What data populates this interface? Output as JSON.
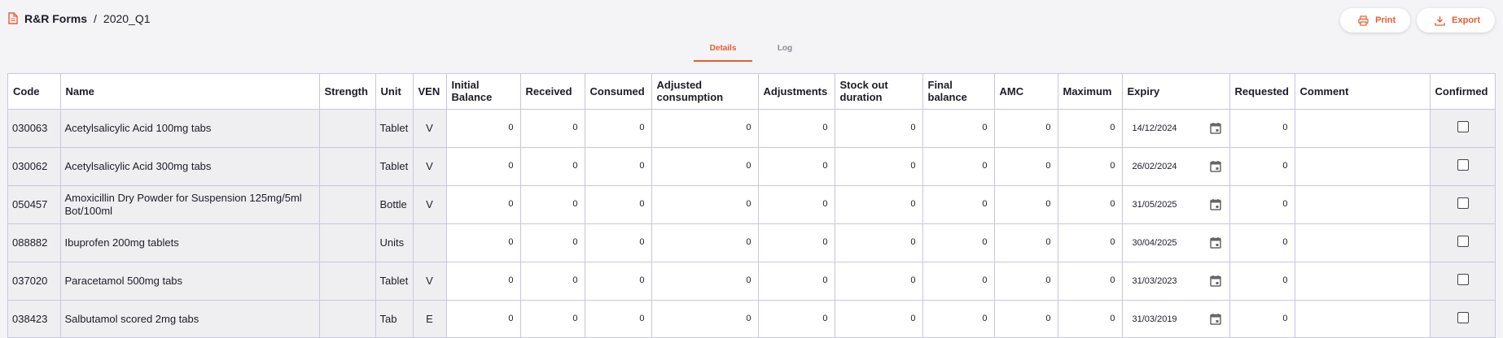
{
  "breadcrumb": {
    "root": "R&R Forms",
    "separator": "/",
    "current": "2020_Q1"
  },
  "toolbar": {
    "print_label": "Print",
    "export_label": "Export"
  },
  "tabs": [
    {
      "label": "Details"
    },
    {
      "label": "Log"
    }
  ],
  "colors": {
    "accent": "#e95c30",
    "border": "#c7c7e0",
    "readonly_cell": "#efeff1"
  },
  "icons": {
    "form": "document-icon",
    "print": "printer-icon",
    "export": "download-icon",
    "expiry": "calendar-icon"
  },
  "table": {
    "columns": [
      {
        "label": "Code"
      },
      {
        "label": "Name"
      },
      {
        "label": "Strength"
      },
      {
        "label": "Unit"
      },
      {
        "label": "VEN"
      },
      {
        "label": "Initial Balance"
      },
      {
        "label": "Received"
      },
      {
        "label": "Consumed"
      },
      {
        "label": "Adjusted consumption"
      },
      {
        "label": "Adjustments"
      },
      {
        "label": "Stock out duration"
      },
      {
        "label": "Final balance"
      },
      {
        "label": "AMC"
      },
      {
        "label": "Maximum"
      },
      {
        "label": "Expiry"
      },
      {
        "label": "Requested"
      },
      {
        "label": "Comment"
      },
      {
        "label": "Confirmed"
      }
    ],
    "rows": [
      {
        "code": "030063",
        "name": "Acetylsalicylic Acid 100mg tabs",
        "strength": "",
        "unit": "Tablet",
        "ven": "V",
        "initial": "0",
        "received": "0",
        "consumed": "0",
        "adjusted": "0",
        "adjustments": "0",
        "stockout": "0",
        "final": "0",
        "amc": "0",
        "maximum": "0",
        "expiry": "14/12/2024",
        "requested": "0",
        "comment": "",
        "confirmed": false
      },
      {
        "code": "030062",
        "name": "Acetylsalicylic Acid 300mg tabs",
        "strength": "",
        "unit": "Tablet",
        "ven": "V",
        "initial": "0",
        "received": "0",
        "consumed": "0",
        "adjusted": "0",
        "adjustments": "0",
        "stockout": "0",
        "final": "0",
        "amc": "0",
        "maximum": "0",
        "expiry": "26/02/2024",
        "requested": "0",
        "comment": "",
        "confirmed": false
      },
      {
        "code": "050457",
        "name": "Amoxicillin Dry Powder for Suspension 125mg/5ml Bot/100ml",
        "strength": "",
        "unit": "Bottle",
        "ven": "V",
        "initial": "0",
        "received": "0",
        "consumed": "0",
        "adjusted": "0",
        "adjustments": "0",
        "stockout": "0",
        "final": "0",
        "amc": "0",
        "maximum": "0",
        "expiry": "31/05/2025",
        "requested": "0",
        "comment": "",
        "confirmed": false
      },
      {
        "code": "088882",
        "name": "Ibuprofen 200mg tablets",
        "strength": "",
        "unit": "Units",
        "ven": "",
        "initial": "0",
        "received": "0",
        "consumed": "0",
        "adjusted": "0",
        "adjustments": "0",
        "stockout": "0",
        "final": "0",
        "amc": "0",
        "maximum": "0",
        "expiry": "30/04/2025",
        "requested": "0",
        "comment": "",
        "confirmed": false
      },
      {
        "code": "037020",
        "name": "Paracetamol 500mg tabs",
        "strength": "",
        "unit": "Tablet",
        "ven": "V",
        "initial": "0",
        "received": "0",
        "consumed": "0",
        "adjusted": "0",
        "adjustments": "0",
        "stockout": "0",
        "final": "0",
        "amc": "0",
        "maximum": "0",
        "expiry": "31/03/2023",
        "requested": "0",
        "comment": "",
        "confirmed": false
      },
      {
        "code": "038423",
        "name": "Salbutamol scored 2mg tabs",
        "strength": "",
        "unit": "Tab",
        "ven": "E",
        "initial": "0",
        "received": "0",
        "consumed": "0",
        "adjusted": "0",
        "adjustments": "0",
        "stockout": "0",
        "final": "0",
        "amc": "0",
        "maximum": "0",
        "expiry": "31/03/2019",
        "requested": "0",
        "comment": "",
        "confirmed": false
      }
    ]
  }
}
